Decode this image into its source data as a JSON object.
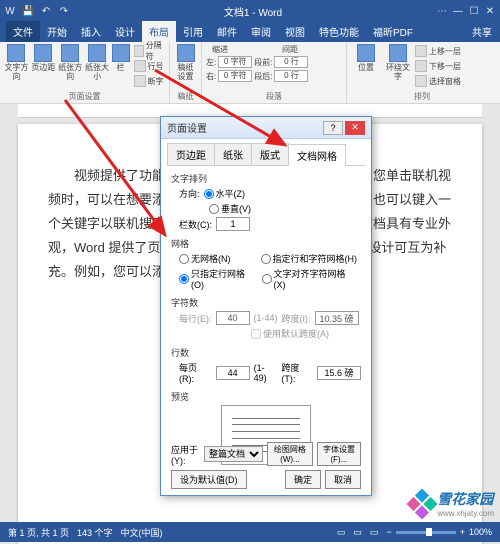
{
  "titlebar": {
    "doc_title": "文档1 - Word",
    "icons": {
      "save": "save-icon",
      "undo": "undo-icon",
      "redo": "redo-icon"
    },
    "win": {
      "min": "—",
      "max": "☐",
      "close": "✕",
      "opts": "⋯",
      "user": "👤"
    }
  },
  "ribbon_tabs": {
    "file": "文件",
    "home": "开始",
    "insert": "插入",
    "design": "设计",
    "layout": "布局",
    "references": "引用",
    "mailings": "邮件",
    "review": "审阅",
    "view": "视图",
    "special": "特色功能",
    "pdf": "福昕PDF",
    "share": "共享"
  },
  "ribbon": {
    "g1": {
      "btn1": "文字方向",
      "btn2": "页边距",
      "btn3": "纸张方向",
      "btn4": "纸张大小",
      "btn5": "栏",
      "sm1": "分隔符",
      "sm2": "行号",
      "sm3": "断字",
      "label": "页面设置"
    },
    "g2": {
      "btn1": "稿纸\n设置",
      "label": "稿纸"
    },
    "g3": {
      "title1": "缩进",
      "title2": "间距",
      "left": "左:",
      "right": "右:",
      "before": "段前:",
      "after": "段后:",
      "val_indent": "0 字符",
      "val_space": "0 行",
      "label": "段落"
    },
    "g4": {
      "btn1": "位置",
      "btn2": "环绕文字",
      "sm1": "上移一层",
      "sm2": "下移一层",
      "sm3": "选择窗格",
      "label": "排列"
    }
  },
  "document_text": "　　视频提供了功能强大的方法帮助您证明您的观点。当您单击联机视频时，可以在想要添加的视频的嵌入代码中进行粘贴。您也可以键入一个关键字以联机搜索最适合您的文档的视频。为使您的文档具有专业外观，Word 提供了页眉、页脚、封面和文本框设计，这些设计可互为补充。例如，您可以添加匹配的封面、页眉和提要栏。",
  "dialog": {
    "title": "页面设置",
    "tabs": {
      "margins": "页边距",
      "paper": "纸张",
      "layout": "版式",
      "grid": "文档网格"
    },
    "sec1": {
      "label": "文字排列",
      "direction": "方向:",
      "horiz": "水平(Z)",
      "vert": "垂直(V)",
      "cols": "栏数(C):",
      "cols_val": "1"
    },
    "sec2": {
      "label": "网格",
      "r1": "无网格(N)",
      "r2": "只指定行网格(O)",
      "r3": "指定行和字符网格(H)",
      "r4": "文字对齐字符网格(X)"
    },
    "sec3": {
      "label": "字符数",
      "perline": "每行(E):",
      "perline_val": "40",
      "perline_range": "(1-44)",
      "pitch1": "跨度(I):",
      "pitch1_val": "10.35 磅",
      "usedefault": "使用默认跨度(A)"
    },
    "sec4": {
      "label": "行数",
      "perpage": "每页(R):",
      "perpage_val": "44",
      "perpage_range": "(1-49)",
      "pitch2": "跨度(T):",
      "pitch2_val": "15.6 磅"
    },
    "sec5": {
      "label": "预览"
    },
    "foot": {
      "apply": "应用于(Y):",
      "apply_val": "整篇文档",
      "drawgrid": "绘图网格(W)...",
      "fontset": "字体设置(F)...",
      "setdefault": "设为默认值(D)",
      "ok": "确定",
      "cancel": "取消"
    }
  },
  "statusbar": {
    "page": "第 1 页, 共 1 页",
    "words": "143 个字",
    "lang": "中文(中国)",
    "zoom": "100%",
    "plus": "+",
    "minus": "−"
  },
  "watermark": {
    "name": "雪花家园",
    "url": "www.xhjaty.com"
  }
}
